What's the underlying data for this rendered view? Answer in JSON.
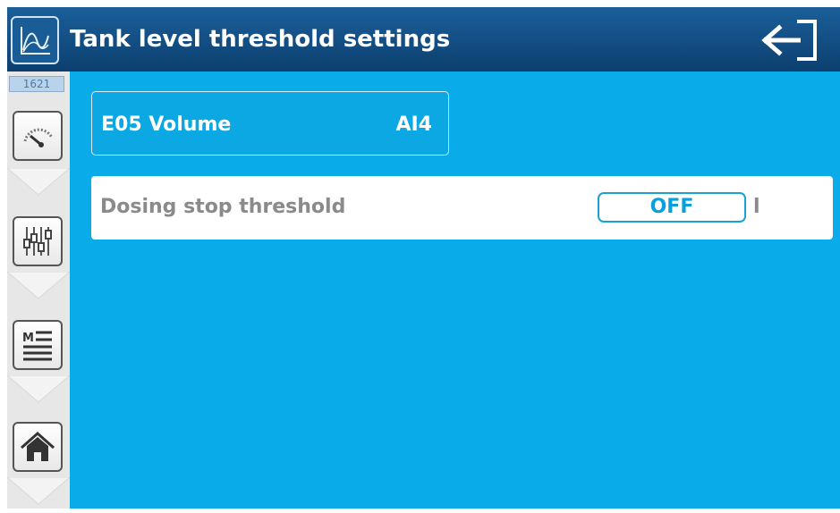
{
  "header": {
    "title": "Tank level threshold settings",
    "icon": "trend-curve-icon",
    "exit_icon": "exit-arrow-icon"
  },
  "sidebar": {
    "counter": "1621",
    "buttons": [
      {
        "icon": "gauge-icon"
      },
      {
        "icon": "sliders-icon"
      },
      {
        "icon": "menu-list-icon"
      },
      {
        "icon": "home-icon"
      }
    ]
  },
  "tile": {
    "name": "E05 Volume",
    "channel": "AI4"
  },
  "setting": {
    "label": "Dosing stop threshold",
    "value": "OFF",
    "unit": "l"
  },
  "colors": {
    "header": "#0c3f6f",
    "content_bg": "#09abe8",
    "sidebar_bg": "#e7e7e7",
    "toggle_text": "#0aa0dc"
  }
}
